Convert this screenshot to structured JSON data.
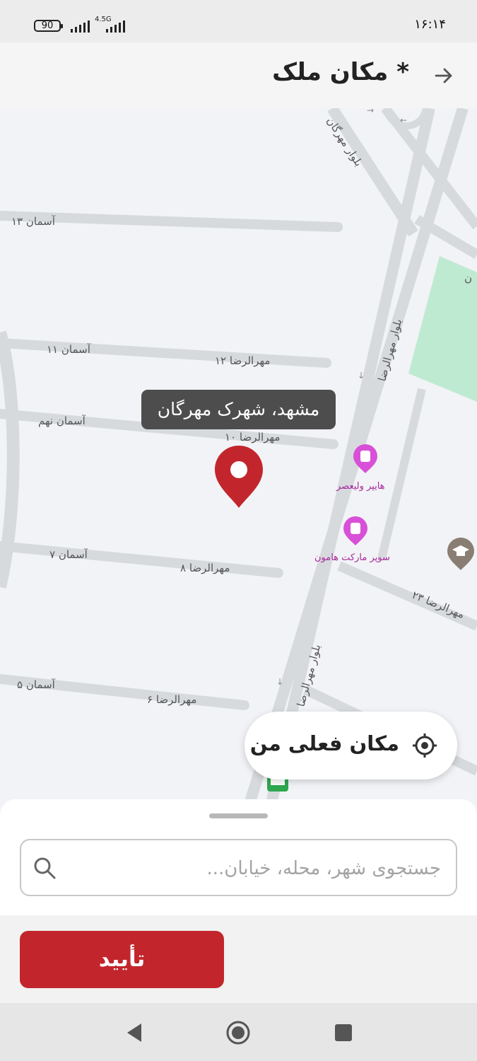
{
  "status_bar": {
    "battery": "90",
    "network": "4.5G",
    "time": "۱۶:۱۴"
  },
  "header": {
    "title": "مکان ملک *",
    "back_icon": "arrow-right-icon"
  },
  "map": {
    "location_tooltip": "مشهد، شهرک مهرگان",
    "street_labels": [
      "آسمان ۱۳",
      "بلوار مهرگان",
      "آسمان ۱۱",
      "مهرالرضا ۱۲",
      "بلوار مهرالرضا",
      "آسمان نهم",
      "مهرالرضا ۱۰",
      "آسمان ۷",
      "مهرالرضا ۸",
      "مهرالرضا ۲۳",
      "بلوار مهرالرضا",
      "آسمان ۵",
      "مهرالرضا ۶",
      "ن"
    ],
    "pois": [
      {
        "label": "هایپر ولیعصر",
        "icon": "shopping-icon"
      },
      {
        "label": "سوپر مارکت هامون",
        "icon": "shopping-icon"
      }
    ],
    "other_icons": [
      "school-icon",
      "bus-stop-icon"
    ],
    "colors": {
      "pin": "#c2262c",
      "park": "#bfead2",
      "road": "#d7dadd",
      "poi": "#d850d8"
    }
  },
  "my_location": {
    "label": "مکان فعلی من",
    "icon": "target-icon"
  },
  "search": {
    "placeholder": "جستجوی شهر، محله، خیابان...",
    "value": ""
  },
  "confirm": {
    "label": "تأیید",
    "color": "#c2262c"
  },
  "nav_bar": {
    "buttons": [
      "back-triangle-icon",
      "home-circle-icon",
      "recents-square-icon"
    ]
  }
}
